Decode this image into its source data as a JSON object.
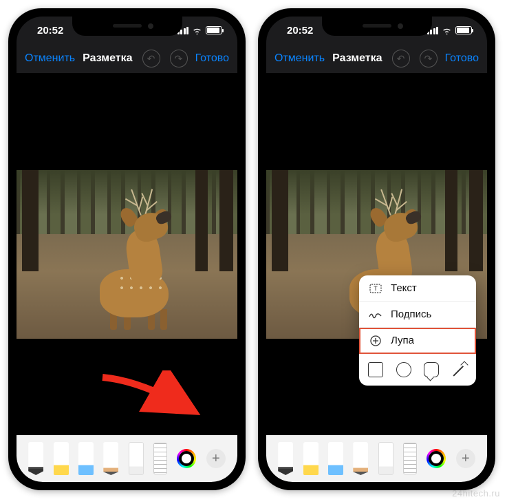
{
  "status": {
    "time": "20:52"
  },
  "nav": {
    "cancel": "Отменить",
    "title": "Разметка",
    "done": "Готово"
  },
  "popup": {
    "text": "Текст",
    "signature": "Подпись",
    "magnifier": "Лупа"
  },
  "icons": {
    "undo": "↶",
    "redo": "↷",
    "plus": "+",
    "text": "T",
    "sign": "✎",
    "mag": "⊕"
  },
  "watermark": "24hitech.ru"
}
